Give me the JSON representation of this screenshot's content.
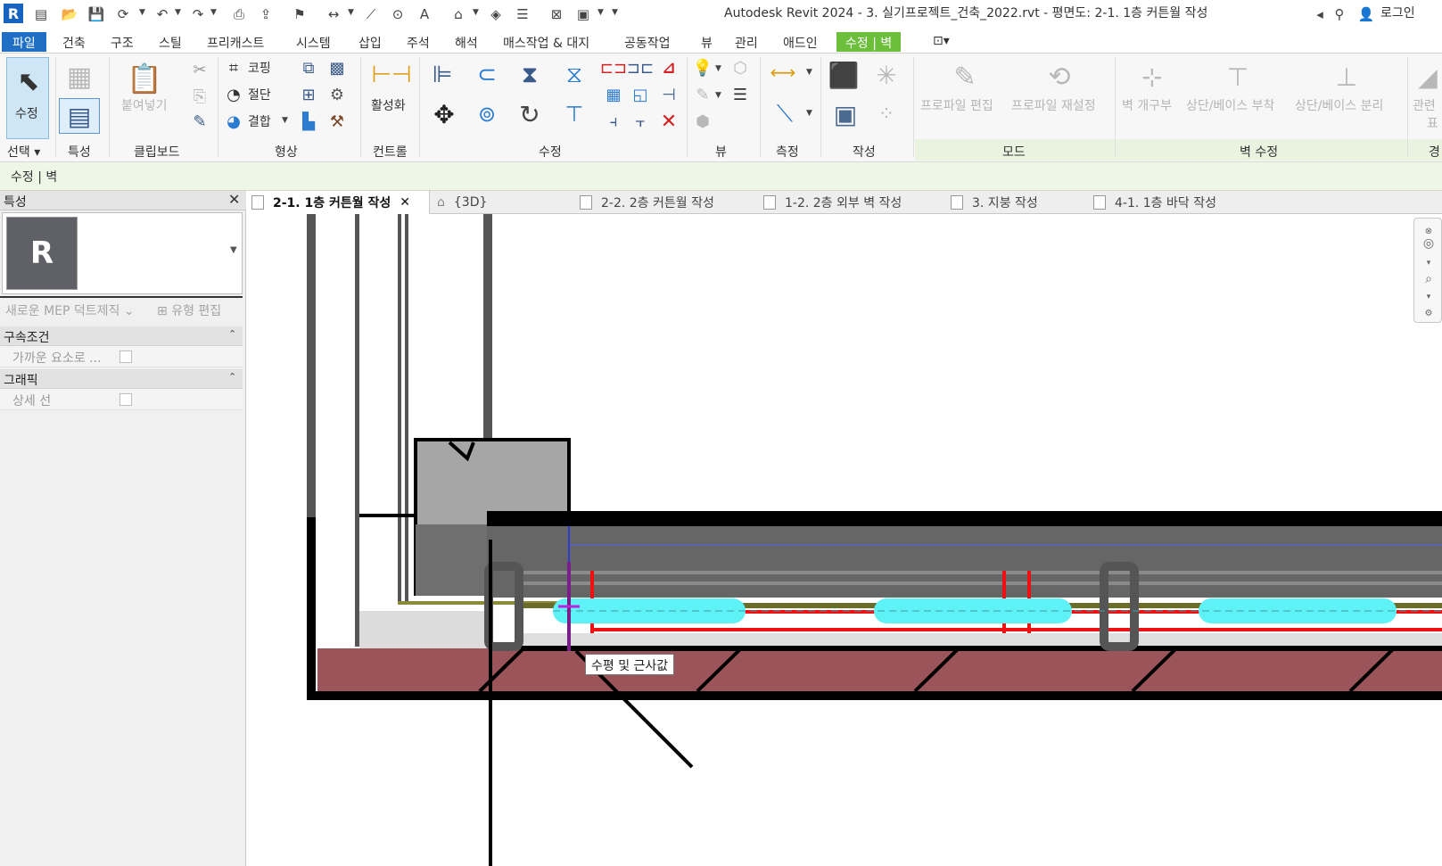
{
  "titlebar": {
    "app_logo": "R",
    "title": "Autodesk Revit 2024 - 3. 실기프로젝트_건축_2022.rvt - 평면도: 2-1. 1층 커튼월 작성",
    "login": "로그인",
    "icons": [
      "info-center-icon",
      "open-icon",
      "save-icon",
      "sync-icon",
      "undo-icon",
      "redo-icon",
      "print-icon",
      "export-icon",
      "measure-icon",
      "dimension-icon",
      "tag-icon",
      "text-icon",
      "3d-view-icon",
      "section-icon",
      "thin-lines-icon",
      "close-hidden-icon",
      "switch-windows-icon",
      "customize-qat-icon"
    ]
  },
  "tabs": {
    "file": "파일",
    "items": [
      "건축",
      "구조",
      "스틸",
      "프리캐스트",
      "시스템",
      "삽입",
      "주석",
      "해석",
      "매스작업 & 대지",
      "공동작업",
      "뷰",
      "관리",
      "애드인"
    ],
    "context": "수정 | 벽"
  },
  "ribbon": {
    "modify_label": "수정",
    "paste_label": "붙여넣기",
    "cope_label": "코핑",
    "cut_label": "절단",
    "join_label": "결합",
    "activate_label": "활성화",
    "edit_profile_label": "프로파일 편집",
    "reset_profile_label": "프로파일 재설정",
    "wall_opening_label": "벽 개구부",
    "attach_label": "상단/베이스 부착",
    "detach_label": "상단/베이스 분리",
    "related_label": "관련",
    "related_label2": "표",
    "panels": {
      "select": "선택",
      "properties": "특성",
      "clipboard": "클립보드",
      "geometry": "형상",
      "controls": "컨트롤",
      "modify": "수정",
      "view": "뷰",
      "measure": "측정",
      "create": "작성",
      "mode": "모드",
      "modify_wall": "벽 수정",
      "partial": "경"
    }
  },
  "options_bar": {
    "text": "수정 | 벽"
  },
  "properties": {
    "title": "특성",
    "type_thumbnail": "R",
    "new_element": "새로운 MEP 덕트제직",
    "edit_type": "유형 편집",
    "groups": [
      {
        "label": "구속조건",
        "rows": [
          {
            "label": "가까운 요소로 ..."
          }
        ]
      },
      {
        "label": "그래픽",
        "rows": [
          {
            "label": "상세 선"
          }
        ]
      }
    ]
  },
  "view_tabs": [
    {
      "label": "2-1. 1층 커튼월 작성",
      "active": true
    },
    {
      "label": "{3D}",
      "active": false
    },
    {
      "label": "2-2. 2층 커튼월 작성",
      "active": false
    },
    {
      "label": "1-2. 2층 외부 벽 작성",
      "active": false
    },
    {
      "label": "3. 지붕 작성",
      "active": false
    },
    {
      "label": "4-1. 1층 바닥 작성",
      "active": false
    }
  ],
  "canvas": {
    "tooltip": "수평 및 근사값"
  },
  "colors": {
    "selection_cyan": "#5ef2f7",
    "accent_green": "#6cbf3b",
    "file_tab_blue": "#1f6fc5",
    "floor_red": "#9b5459"
  }
}
